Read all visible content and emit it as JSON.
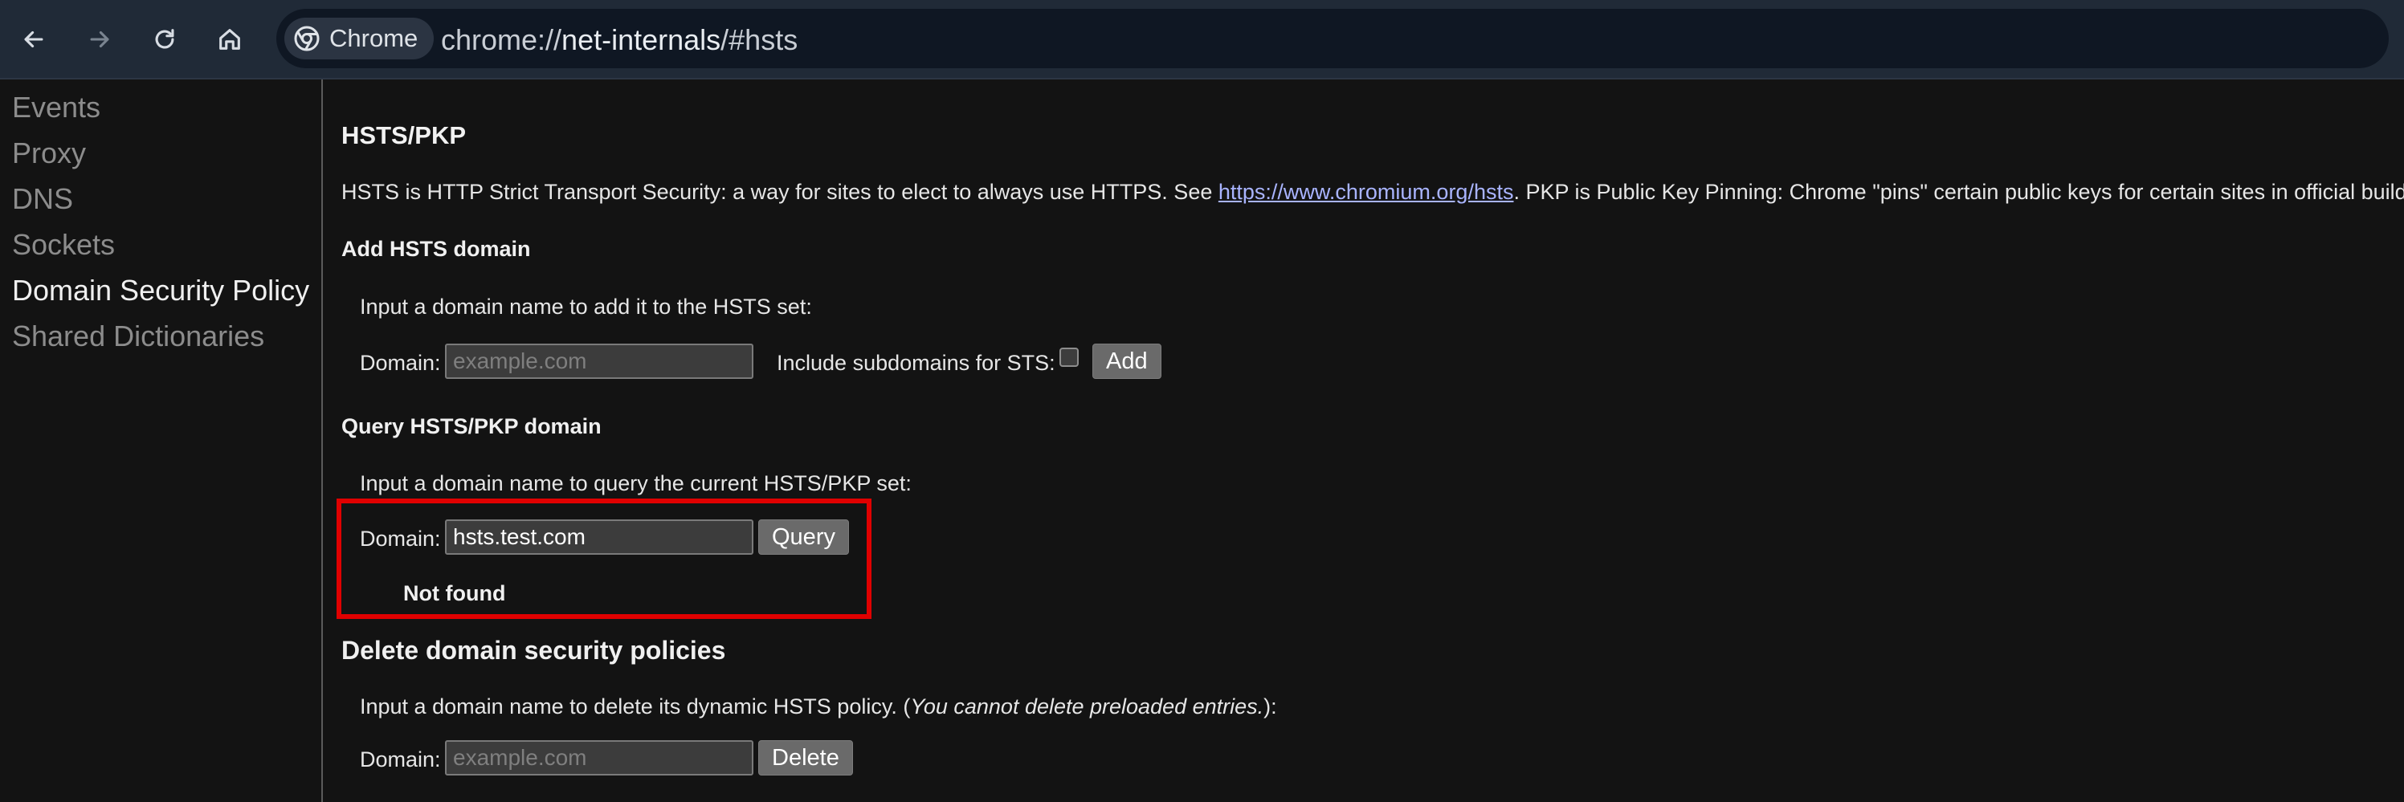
{
  "browser": {
    "chip_label": "Chrome",
    "url_scheme": "chrome://",
    "url_host": "net-internals",
    "url_path": "/#hsts"
  },
  "sidebar": {
    "items": [
      {
        "label": "Events",
        "active": false
      },
      {
        "label": "Proxy",
        "active": false
      },
      {
        "label": "DNS",
        "active": false
      },
      {
        "label": "Sockets",
        "active": false
      },
      {
        "label": "Domain Security Policy",
        "active": true
      },
      {
        "label": "Shared Dictionaries",
        "active": false
      }
    ]
  },
  "main": {
    "title": "HSTS/PKP",
    "description": {
      "before_link": "HSTS is HTTP Strict Transport Security: a way for sites to elect to always use HTTPS. See ",
      "link": "https://www.chromium.org/hsts",
      "after_link": ". PKP is Public Key Pinning: Chrome \"pins\" certain public keys for certain sites in official builds."
    },
    "add": {
      "heading": "Add HSTS domain",
      "instruction": "Input a domain name to add it to the HSTS set:",
      "domain_label": "Domain:",
      "domain_placeholder": "example.com",
      "subdomains_label": "Include subdomains for STS:",
      "button": "Add"
    },
    "query": {
      "heading": "Query HSTS/PKP domain",
      "instruction": "Input a domain name to query the current HSTS/PKP set:",
      "domain_label": "Domain:",
      "domain_value": "hsts.test.com",
      "button": "Query",
      "result": "Not found"
    },
    "delete": {
      "heading": "Delete domain security policies",
      "instruction_before": "Input a domain name to delete its dynamic HSTS policy. (",
      "instruction_italic": "You cannot delete preloaded entries.",
      "instruction_after": "):",
      "domain_label": "Domain:",
      "domain_placeholder": "example.com",
      "button": "Delete"
    }
  },
  "colors": {
    "highlight": "#e00000",
    "link": "#a9b4ff"
  }
}
